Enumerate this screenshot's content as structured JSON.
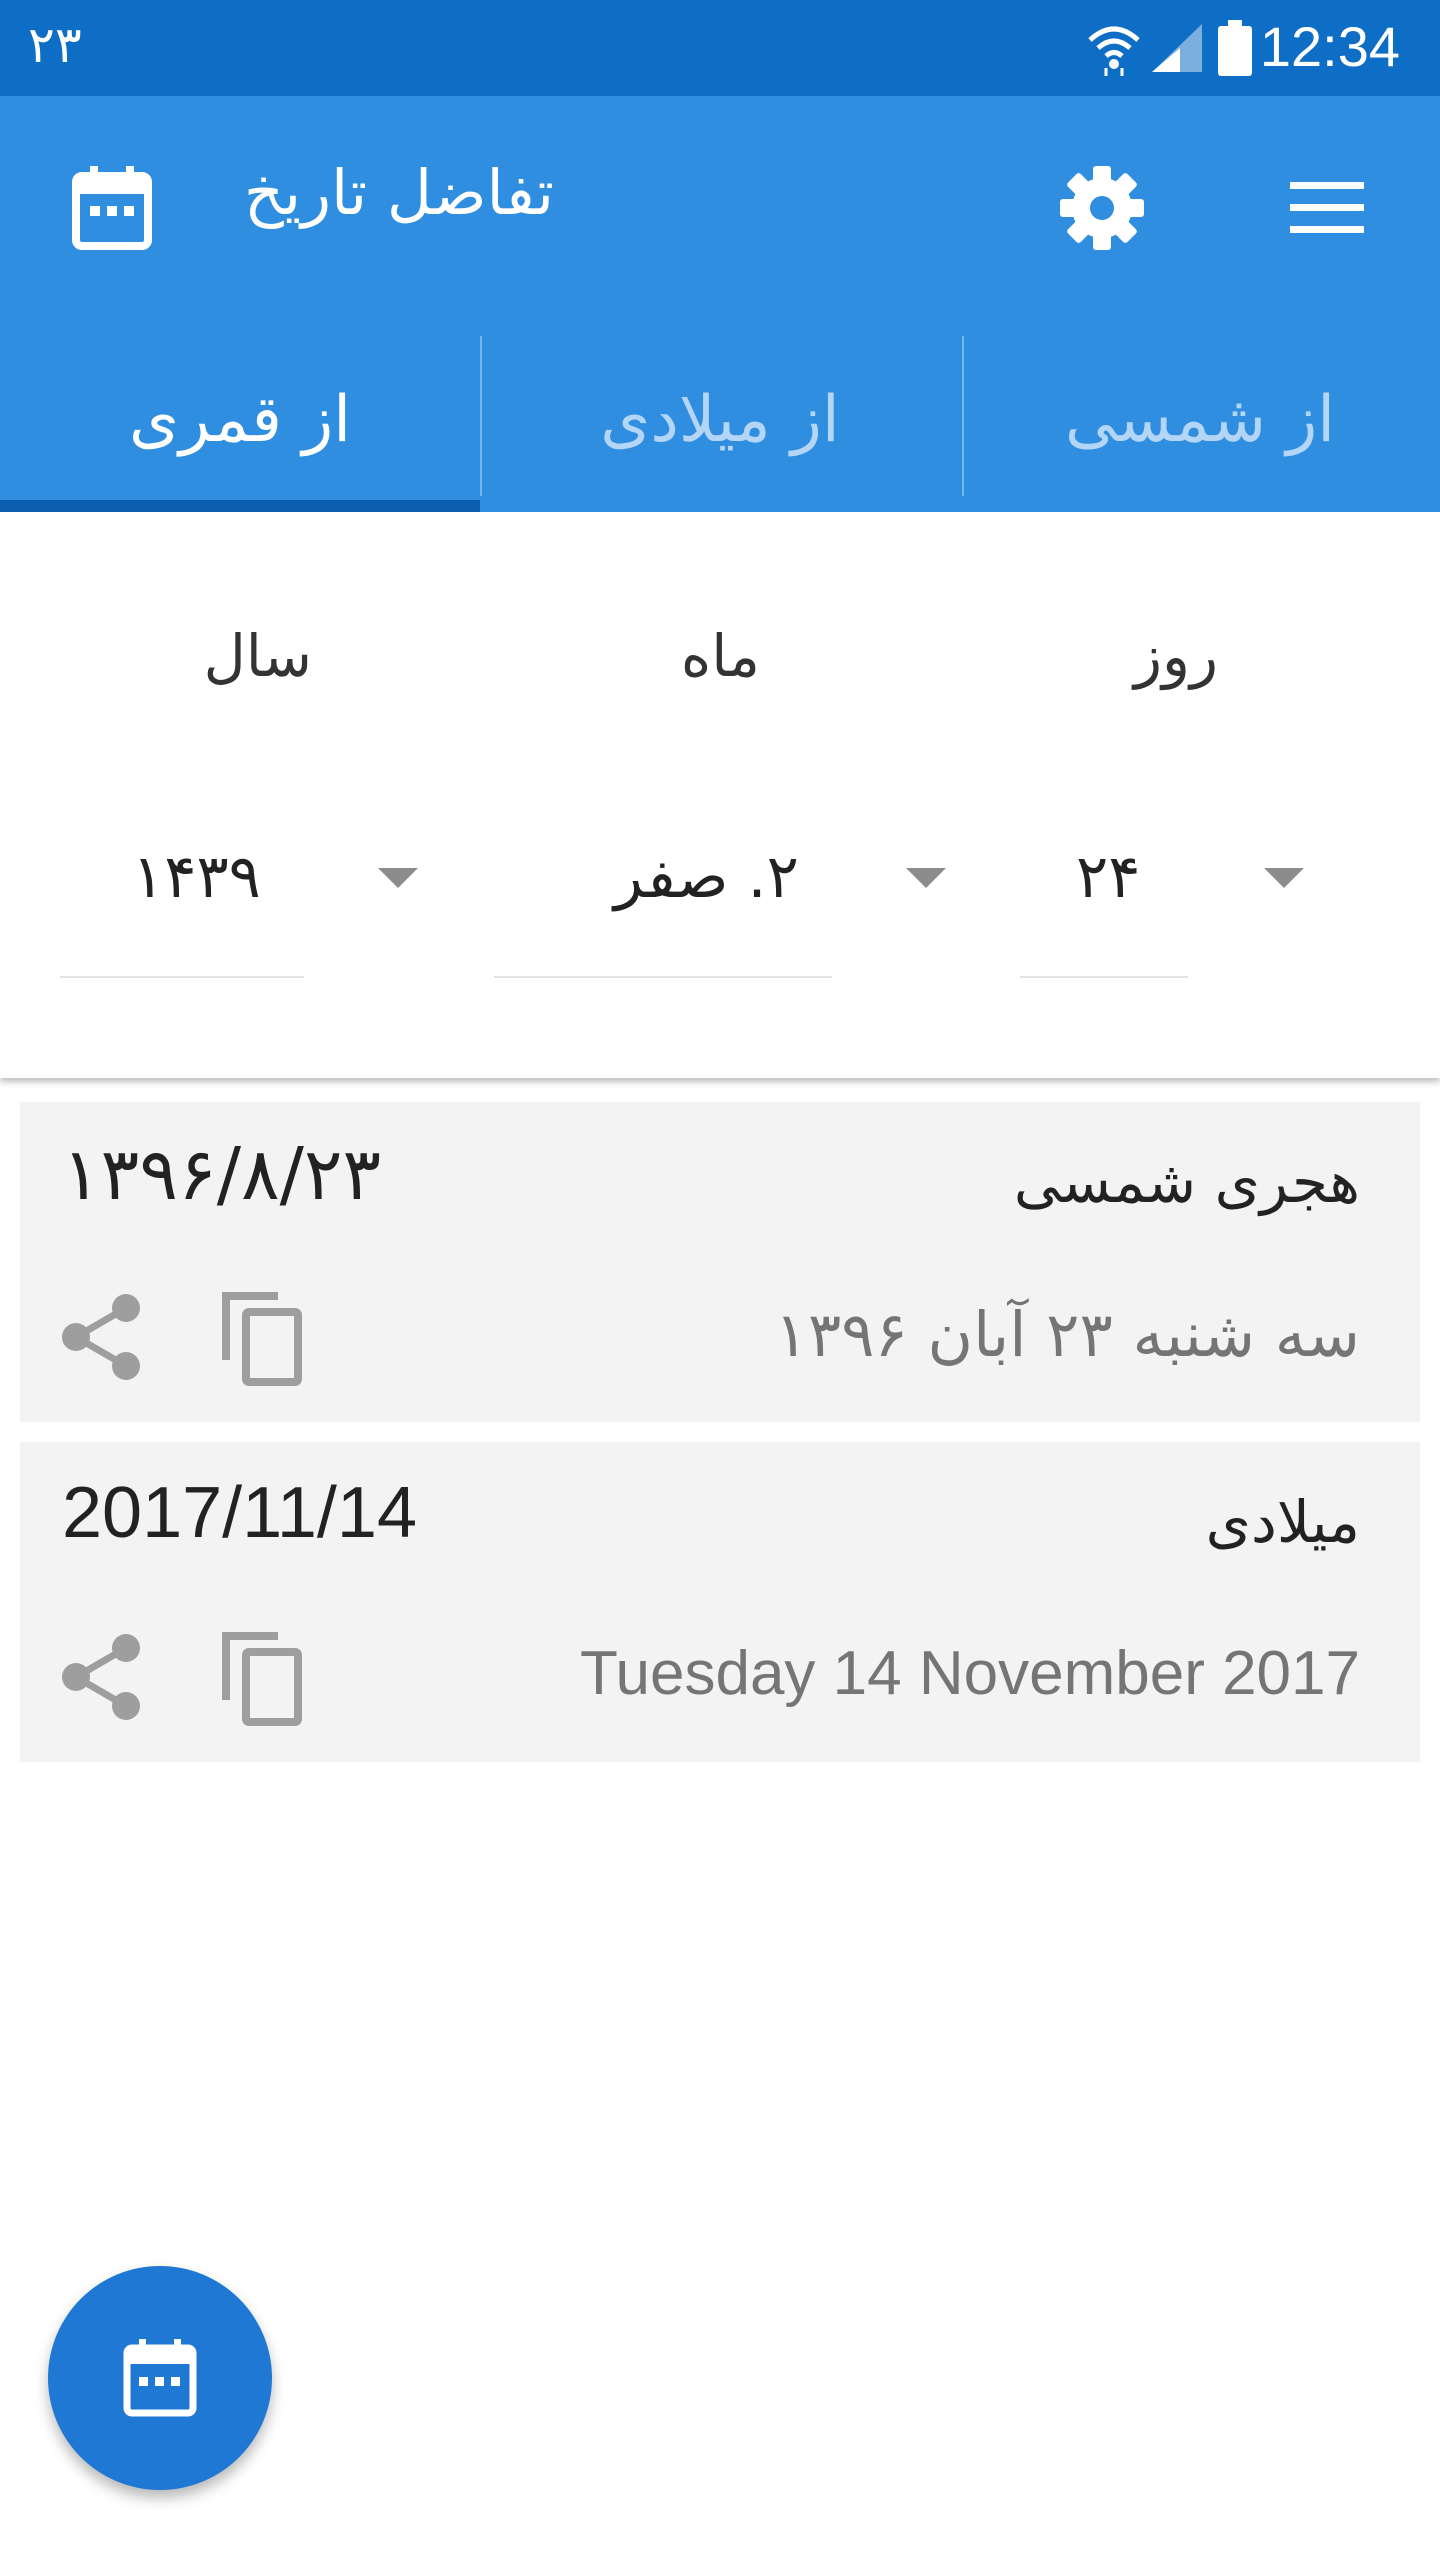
{
  "status_bar": {
    "left_text": "۲۳",
    "time": "12:34",
    "icons": [
      "wifi-icon",
      "signal-icon",
      "battery-icon"
    ]
  },
  "toolbar": {
    "title": "تفاضل تاریخ",
    "icons": [
      "calendar-icon",
      "settings-icon",
      "menu-icon"
    ]
  },
  "tabs": [
    {
      "label": "از شمسی",
      "active": false
    },
    {
      "label": "از میلادی",
      "active": false
    },
    {
      "label": "از قمری",
      "active": true
    }
  ],
  "picker": {
    "day_label": "روز",
    "month_label": "ماه",
    "year_label": "سال",
    "day_value": "۲۴",
    "month_value": "۲. صفر",
    "year_value": "۱۴۳۹"
  },
  "results": [
    {
      "title": "هجری شمسی",
      "date": "۱۳۹۶/۸/۲۳",
      "full": "سه شنبه ۲۳ آبان ۱۳۹۶"
    },
    {
      "title": "میلادی",
      "date": "2017/11/14",
      "full": "Tuesday 14 November 2017"
    }
  ],
  "colors": {
    "status_bar": "#0E6DC4",
    "primary": "#308EE0",
    "fab": "#1E78D4",
    "card_bg": "#F3F3F3"
  }
}
